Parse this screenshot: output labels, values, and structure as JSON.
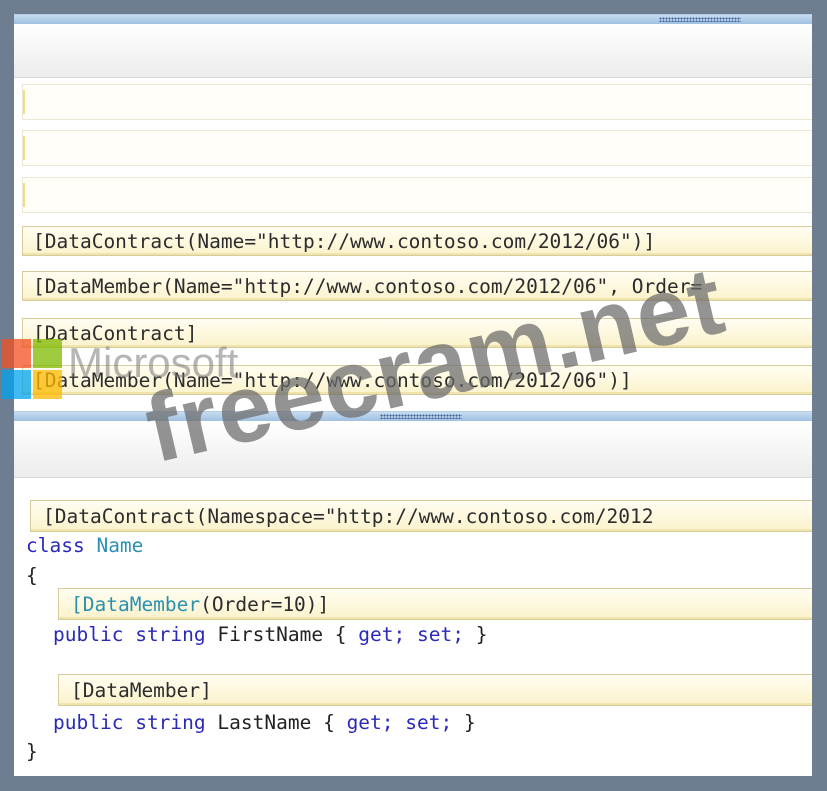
{
  "answer_options": [
    "[DataContract(Name=\"http://www.contoso.com/2012/06\")]",
    "[DataMember(Name=\"http://www.contoso.com/2012/06\", Order=",
    "[DataContract]",
    "[DataMember(Name=\"http://www.contoso.com/2012/06\")]"
  ],
  "code": {
    "class_attribute": "[DataContract(Namespace=\"http://www.contoso.com/2012",
    "class_keyword": "class",
    "class_name": "Name",
    "open_brace": "{",
    "member1_attr_name": "[DataMember",
    "member1_attr_args": "(Order=10)]",
    "member1_public": "public",
    "member1_string": "string",
    "member1_name": "FirstName {",
    "member1_get": "get;",
    "member1_set": "set;",
    "member1_close": "}",
    "member2_attr": "[DataMember]",
    "member2_public": "public",
    "member2_string": "string",
    "member2_name": "LastName {",
    "member2_get": "get;",
    "member2_set": "set;",
    "member2_close": "}",
    "close_brace": "}"
  },
  "watermark": {
    "logo_text": "Microsoft",
    "site_text": "freecram.net"
  },
  "colors": {
    "keyword": "#2a2ab8",
    "type_name": "#2b91af",
    "slot_fill": "#fbf3cc",
    "splitter": "#9fc0e2"
  }
}
